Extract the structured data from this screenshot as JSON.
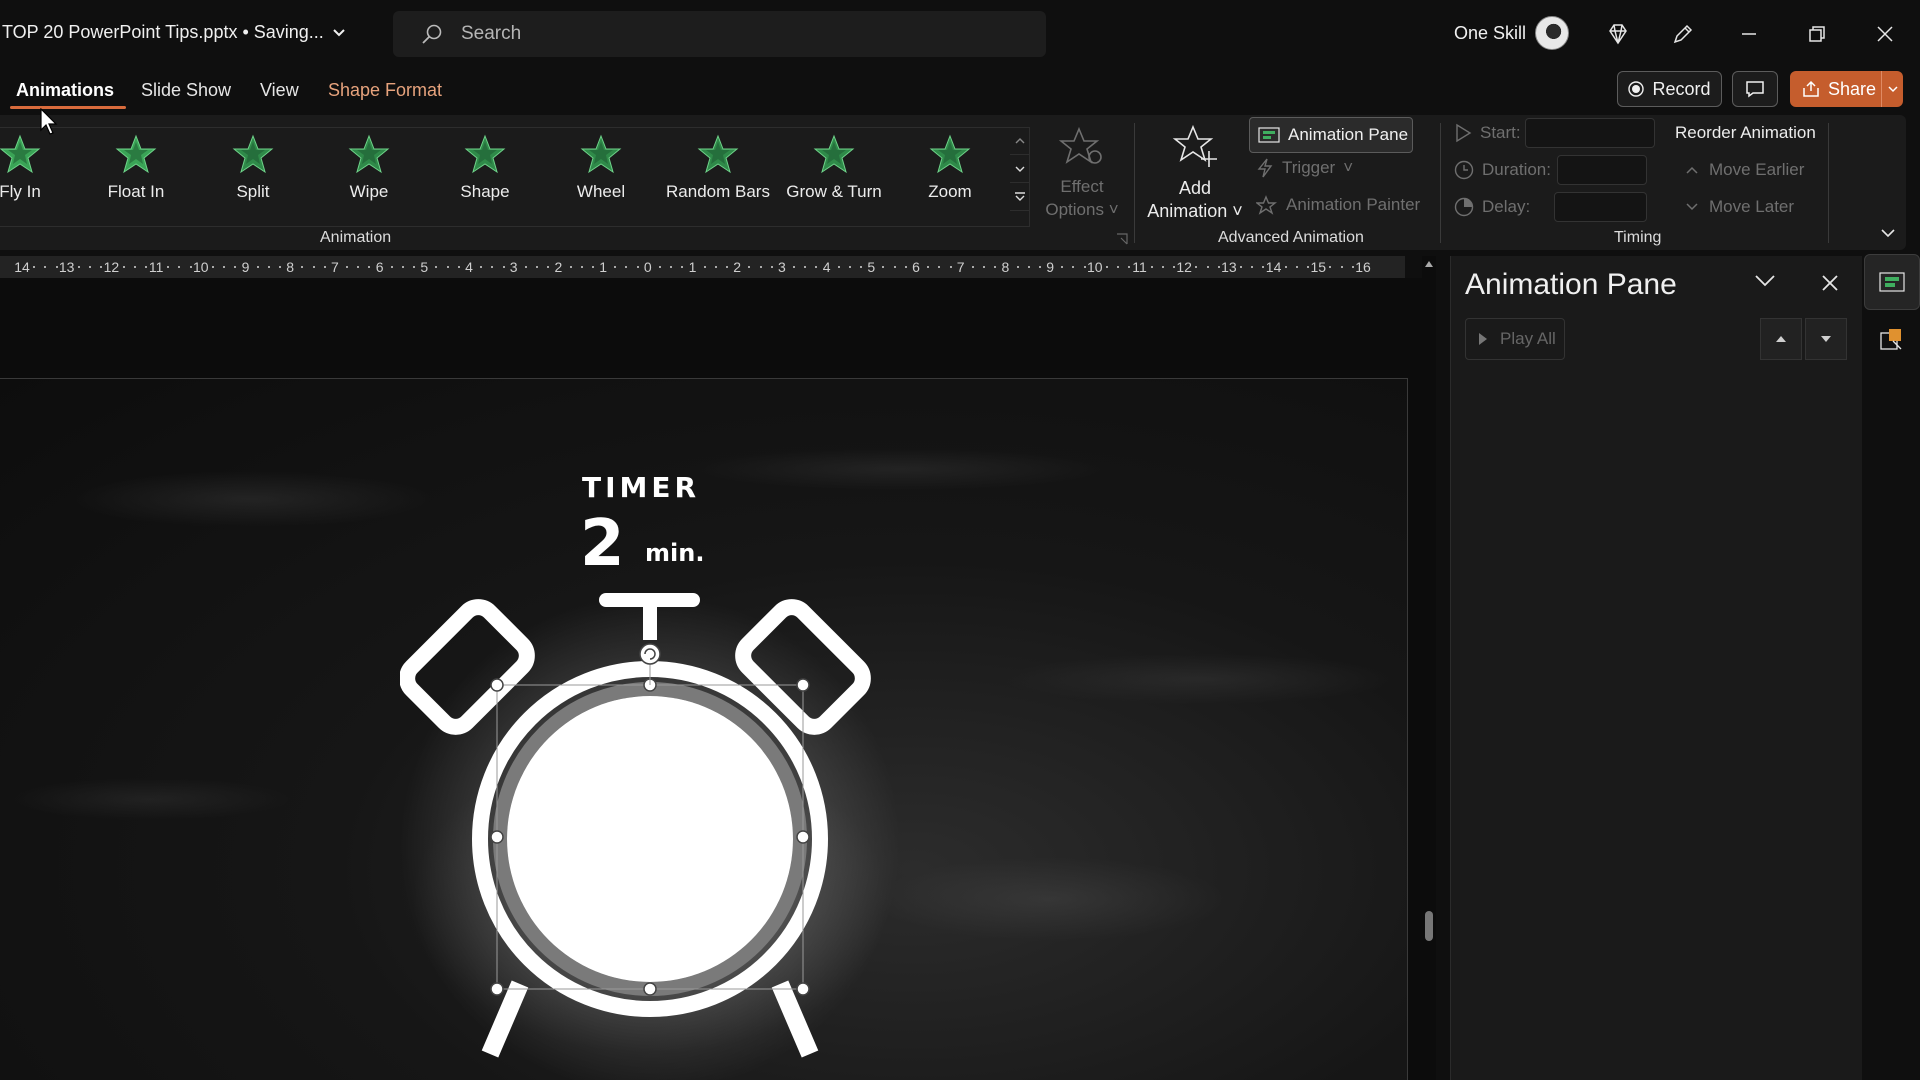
{
  "titlebar": {
    "doc_title": "TOP 20 PowerPoint Tips.pptx • Saving...",
    "search_placeholder": "Search",
    "user_name": "One Skill"
  },
  "tabs": [
    {
      "label": "Animations",
      "active": true
    },
    {
      "label": "Slide Show"
    },
    {
      "label": "View"
    },
    {
      "label": "Shape Format",
      "contextual": true
    }
  ],
  "actions": {
    "record_label": "Record",
    "share_label": "Share"
  },
  "ribbon": {
    "animations": [
      "Fly In",
      "Float In",
      "Split",
      "Wipe",
      "Shape",
      "Wheel",
      "Random Bars",
      "Grow & Turn",
      "Zoom"
    ],
    "effect_options_line1": "Effect",
    "effect_options_line2": "Options",
    "group_animation": "Animation",
    "add_animation_line1": "Add",
    "add_animation_line2": "Animation",
    "animation_pane_label": "Animation Pane",
    "trigger_label": "Trigger",
    "animation_painter_label": "Animation Painter",
    "group_advanced": "Advanced Animation",
    "start_label": "Start:",
    "duration_label": "Duration:",
    "delay_label": "Delay:",
    "group_timing": "Timing",
    "reorder_title": "Reorder Animation",
    "move_earlier": "Move Earlier",
    "move_later": "Move Later"
  },
  "ruler": {
    "labels": [
      "14",
      "13",
      "12",
      "11",
      "10",
      "9",
      "8",
      "7",
      "6",
      "5",
      "4",
      "3",
      "2",
      "1",
      "0",
      "1",
      "2",
      "3",
      "4",
      "5",
      "6",
      "7",
      "8",
      "9",
      "10",
      "11",
      "12",
      "13",
      "14",
      "15",
      "16"
    ]
  },
  "slide": {
    "title": "TIMER",
    "number": "2",
    "unit": "min."
  },
  "pane": {
    "title": "Animation Pane",
    "play_all": "Play All"
  },
  "colors": {
    "accent": "#c55d2d",
    "contextual_tab": "#e7a37d",
    "star_green": "#2f8f4a"
  }
}
